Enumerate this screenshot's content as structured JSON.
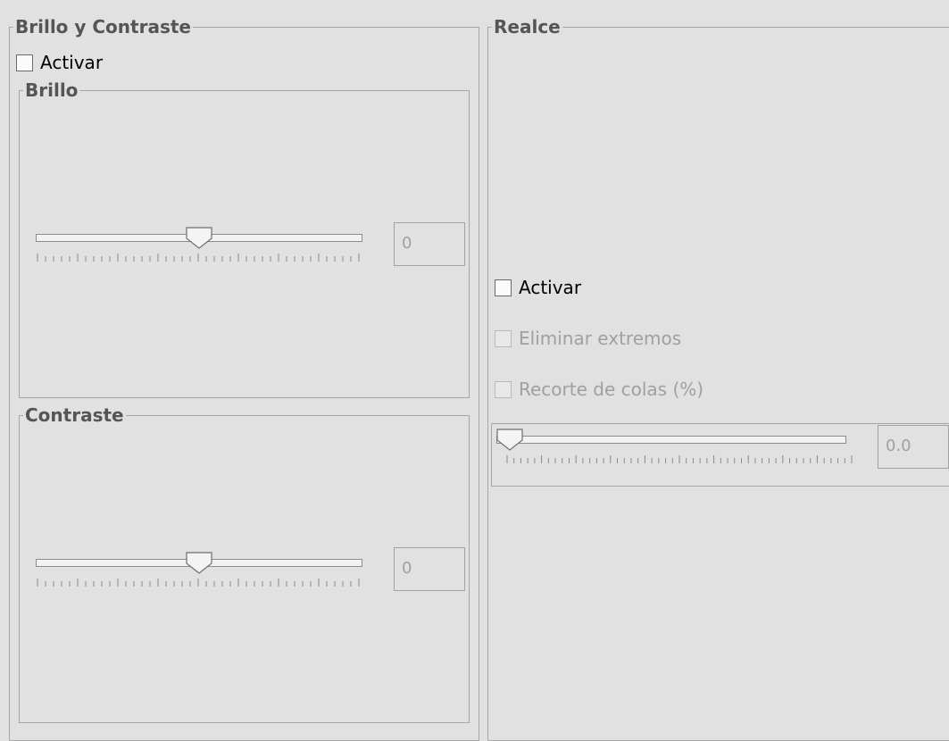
{
  "brillo_contraste": {
    "title": "Brillo y Contraste",
    "activar_label": "Activar",
    "activar_checked": false,
    "brillo": {
      "title": "Brillo",
      "value": "0",
      "slider_fraction": 0.5
    },
    "contraste": {
      "title": "Contraste",
      "value": "0",
      "slider_fraction": 0.5
    }
  },
  "realce": {
    "title": "Realce",
    "activar_label": "Activar",
    "activar_checked": false,
    "eliminar_label": "Eliminar extremos",
    "eliminar_enabled": false,
    "recorte_label": "Recorte de colas (%)",
    "recorte_enabled": false,
    "recorte_value": "0.0",
    "recorte_slider_fraction": 0.0
  }
}
